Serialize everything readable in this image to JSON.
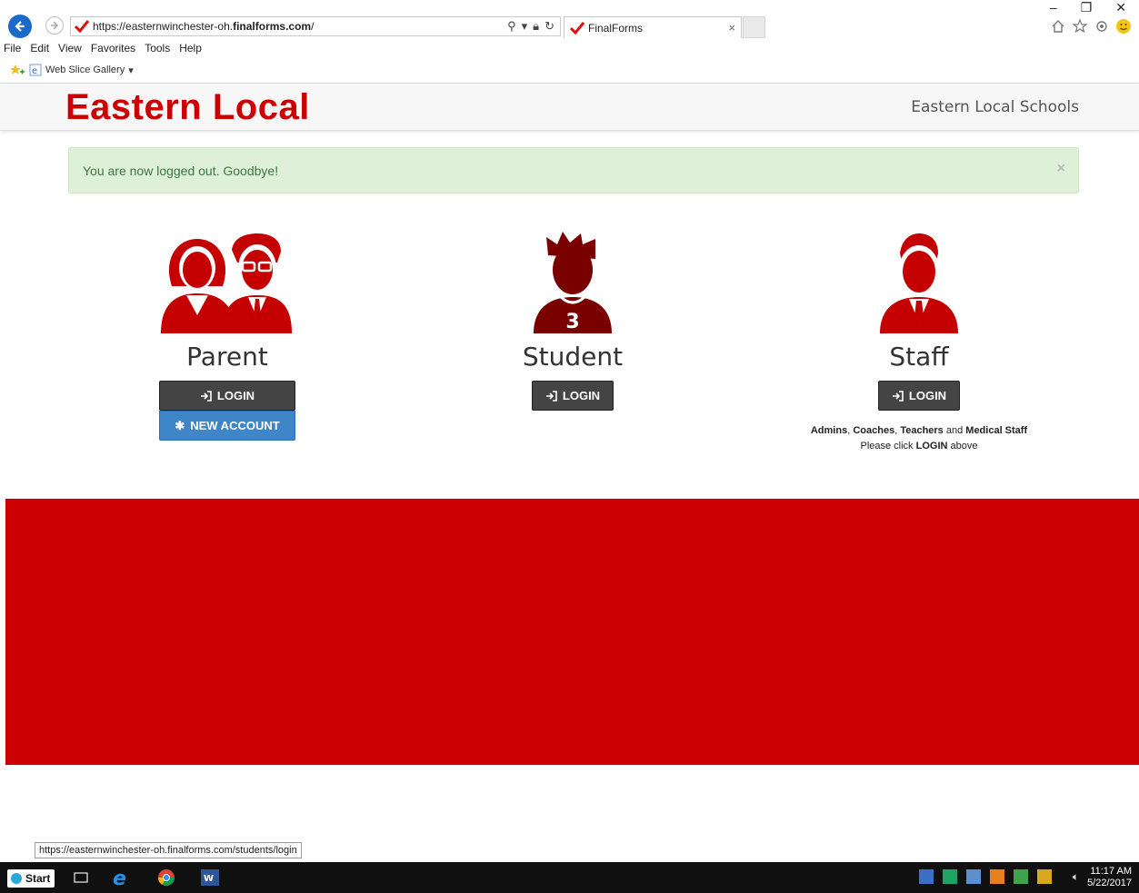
{
  "browser": {
    "url_prefix": "https://easternwinchester-oh.",
    "url_bold": "finalforms.com",
    "url_suffix": "/",
    "tab_title": "FinalForms",
    "tab_close": "×",
    "menu": [
      "File",
      "Edit",
      "View",
      "Favorites",
      "Tools",
      "Help"
    ],
    "favorites_item": "Web Slice Gallery",
    "window_controls": {
      "minimize": "–",
      "restore": "❐",
      "close": "✕"
    }
  },
  "site": {
    "brand": "Eastern Local",
    "school_name": "Eastern Local Schools"
  },
  "alert": {
    "message": "You are now logged out. Goodbye!",
    "close": "×"
  },
  "roles": {
    "parent": {
      "title": "Parent",
      "login": "LOGIN",
      "new_account": "NEW ACCOUNT"
    },
    "student": {
      "title": "Student",
      "login": "LOGIN",
      "jersey_number": "3"
    },
    "staff": {
      "title": "Staff",
      "login": "LOGIN",
      "note_admins": "Admins",
      "note_sep1": ", ",
      "note_coaches": "Coaches",
      "note_sep2": ", ",
      "note_teachers": "Teachers",
      "note_and": " and ",
      "note_medical": "Medical Staff",
      "note_line2_pre": "Please click ",
      "note_line2_bold": "LOGIN",
      "note_line2_post": " above"
    }
  },
  "status_url": "https://easternwinchester-oh.finalforms.com/students/login",
  "taskbar": {
    "start_label": "Start",
    "time": "11:17 AM",
    "date": "5/22/2017"
  },
  "colors": {
    "brand_red": "#cc0000",
    "login_dark": "#444444",
    "new_account_blue": "#3f86c9",
    "alert_green_bg": "#dff0d8"
  }
}
